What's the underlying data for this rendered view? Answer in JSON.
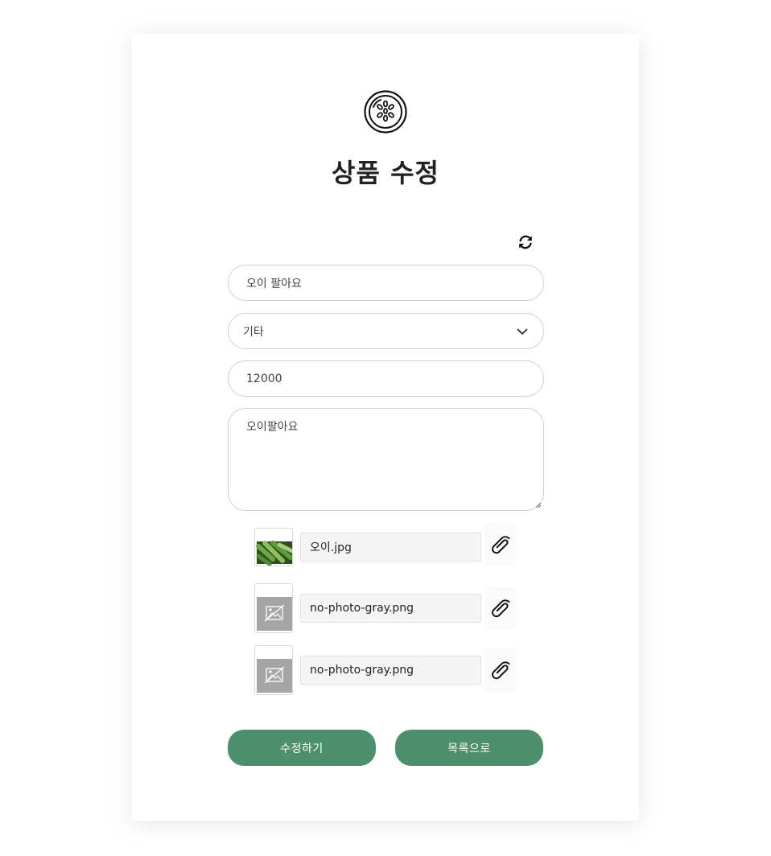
{
  "header": {
    "title": "상품 수정",
    "logo_icon": "cucumber-slice-icon"
  },
  "toolbar": {
    "reset_icon": "refresh-icon"
  },
  "form": {
    "name_value": "오이 팔아요",
    "category_value": "기타",
    "price_value": "12000",
    "description_value": "오이팔아요"
  },
  "images": [
    {
      "filename": "오이.jpg",
      "kind": "photo"
    },
    {
      "filename": "no-photo-gray.png",
      "kind": "placeholder"
    },
    {
      "filename": "no-photo-gray.png",
      "kind": "placeholder"
    }
  ],
  "actions": {
    "edit_label": "수정하기",
    "list_label": "목록으로"
  },
  "colors": {
    "accent": "#4e8f6d",
    "border": "#cfcfcf",
    "placeholder_gray": "#a5a5a5"
  }
}
